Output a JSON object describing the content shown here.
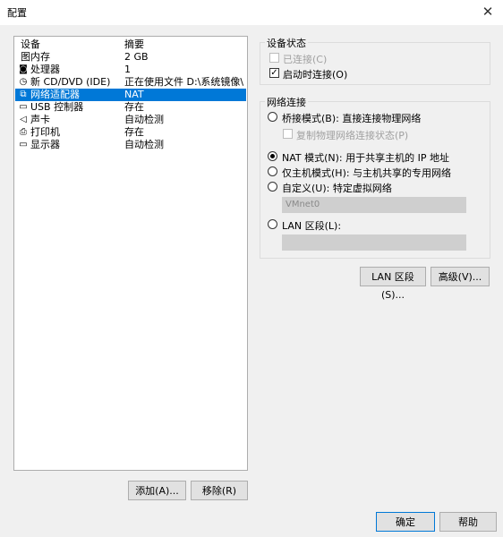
{
  "window": {
    "title": "配置",
    "close_glyph": "✕"
  },
  "device_list": {
    "header": {
      "device": "设备",
      "summary": "摘要"
    },
    "items": [
      {
        "icon": "memory-icon",
        "glyph": "",
        "name": "图内存",
        "summary": "2 GB",
        "selected": false
      },
      {
        "icon": "processor-icon",
        "glyph": "◙",
        "name": "处理器",
        "summary": "1",
        "selected": false
      },
      {
        "icon": "cd-dvd-icon",
        "glyph": "◷",
        "name": "新 CD/DVD (IDE)",
        "summary": "正在使用文件 D:\\系统镜像\\...",
        "selected": false
      },
      {
        "icon": "network-adapter-icon",
        "glyph": "⧉",
        "name": "网络适配器",
        "summary": "NAT",
        "selected": true
      },
      {
        "icon": "usb-controller-icon",
        "glyph": "▭",
        "name": "USB 控制器",
        "summary": "存在",
        "selected": false
      },
      {
        "icon": "sound-card-icon",
        "glyph": "◁",
        "name": "声卡",
        "summary": "自动检测",
        "selected": false
      },
      {
        "icon": "printer-icon",
        "glyph": "⎙",
        "name": "打印机",
        "summary": "存在",
        "selected": false
      },
      {
        "icon": "display-icon",
        "glyph": "▭",
        "name": "显示器",
        "summary": "自动检测",
        "selected": false
      }
    ],
    "add_button": "添加(A)...",
    "remove_button": "移除(R)"
  },
  "device_status": {
    "title": "设备状态",
    "connected_label": "已连接(C)",
    "connected_checked": false,
    "connect_on_power_label": "启动时连接(O)",
    "connect_on_power_checked": true
  },
  "network_connection": {
    "title": "网络连接",
    "bridged_label": "桥接模式(B): 直接连接物理网络",
    "replicate_label": "复制物理网络连接状态(P)",
    "replicate_checked": false,
    "nat_label": "NAT 模式(N): 用于共享主机的 IP 地址",
    "host_only_label": "仅主机模式(H): 与主机共享的专用网络",
    "custom_label": "自定义(U): 特定虚拟网络",
    "custom_field_value": "VMnet0",
    "lan_segment_label": "LAN 区段(L):",
    "lan_segment_field_value": "",
    "selected": "nat"
  },
  "buttons": {
    "lan_segments": "LAN 区段(S)...",
    "advanced": "高级(V)...",
    "ok": "确定",
    "help": "帮助"
  }
}
